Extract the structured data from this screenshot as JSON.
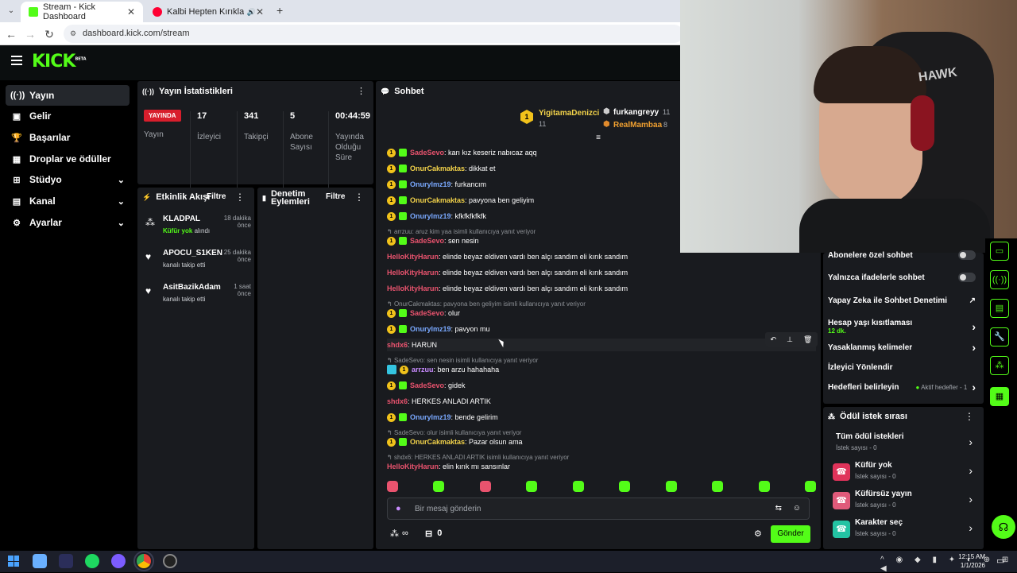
{
  "browser": {
    "tabs": [
      {
        "title": "Stream - Kick Dashboard",
        "favicon_color": "#53fc18"
      },
      {
        "title": "Kalbi Hepten Kırıklara (feat",
        "favicon_color": "#ff0033"
      }
    ],
    "new_tab": "+",
    "url": "dashboard.kick.com/stream"
  },
  "kick": {
    "logo": "KICK",
    "logo_badge": "BETA",
    "accent_color": "#53fc18"
  },
  "sidebar": {
    "items": [
      {
        "label": "Yayın",
        "icon": "broadcast-icon",
        "glyph": "((·))",
        "active": true
      },
      {
        "label": "Gelir",
        "icon": "revenue-icon",
        "glyph": "▣"
      },
      {
        "label": "Başarılar",
        "icon": "trophy-icon",
        "glyph": "🏆"
      },
      {
        "label": "Droplar ve ödüller",
        "icon": "gift-icon",
        "glyph": "▦"
      },
      {
        "label": "Stüdyo",
        "icon": "studio-icon",
        "glyph": "⊞",
        "expandable": true
      },
      {
        "label": "Kanal",
        "icon": "channel-icon",
        "glyph": "▤",
        "expandable": true
      },
      {
        "label": "Ayarlar",
        "icon": "settings-icon",
        "glyph": "⚙",
        "expandable": true
      }
    ]
  },
  "stats": {
    "title": "Yayın İstatistikleri",
    "live_badge": "YAYINDA",
    "live_label": "Yayın",
    "items": [
      {
        "value": "17",
        "label": "İzleyici"
      },
      {
        "value": "341",
        "label": "Takipçi"
      },
      {
        "value": "5",
        "label": "Abone Sayısı"
      },
      {
        "value": "00:44:59",
        "label": "Yayında Olduğu Süre"
      }
    ]
  },
  "activity": {
    "title": "Etkinlik Akışı",
    "filter": "Filtre",
    "events": [
      {
        "name": "KLADPAL",
        "time": "18 dakika önce",
        "highlight": "Küfür yok",
        "desc": " alındı",
        "icon": "reward-icon"
      },
      {
        "name": "APOCU_S1KEN",
        "time": "25 dakika önce",
        "highlight": "",
        "desc": "kanalı takip etti",
        "icon": "heart-icon"
      },
      {
        "name": "AsitBazikAdam",
        "time": "1 saat önce",
        "highlight": "",
        "desc": "kanalı takip etti",
        "icon": "heart-icon"
      }
    ]
  },
  "moderation": {
    "title": "Denetim Eylemleri",
    "filter": "Filtre"
  },
  "chat": {
    "title": "Sohbet",
    "leaderboard": [
      {
        "name": "YigitamaDenizci",
        "count": "11",
        "rank": "1"
      },
      {
        "name": "furkangreyy",
        "count": "11"
      },
      {
        "name": "RealMambaa",
        "count": "8"
      }
    ],
    "messages": [
      {
        "user": "SadeSevo",
        "color": "#e9536e",
        "badges": [
          "sub",
          "gift"
        ],
        "text": ": karı kız keseriz nabıcaz aqq"
      },
      {
        "user": "OnurCakmaktas",
        "color": "#f3d34a",
        "badges": [
          "sub",
          "gift"
        ],
        "text": ": dikkat et",
        "alt_user": "Onurylmz19",
        "alt_color": "#7aa9ff"
      },
      {
        "user": "Onurylmz19",
        "color": "#7aa9ff",
        "badges": [
          "sub",
          "gift"
        ],
        "text": ": furkancım"
      },
      {
        "user": "OnurCakmaktas",
        "color": "#f3d34a",
        "badges": [
          "sub",
          "gift"
        ],
        "text": ": pavyona ben geliyim"
      },
      {
        "user": "Onurylmz19",
        "color": "#7aa9ff",
        "badges": [
          "sub",
          "gift"
        ],
        "text": ": kfkfkfkfkfk"
      },
      {
        "reply": "arrzuu: aruz kim yaa isimli kullanıcıya yanıt veriyor"
      },
      {
        "user": "SadeSevo",
        "color": "#e9536e",
        "badges": [
          "sub",
          "gift"
        ],
        "text": ": sen nesin"
      },
      {
        "user": "HelloKityHarun",
        "color": "#e9536e",
        "badges": [],
        "text": ": elinde beyaz eldiven vardı ben alçı sandım eli kırık sandım"
      },
      {
        "user": "HelloKityHarun",
        "color": "#e9536e",
        "badges": [],
        "text": ": elinde beyaz eldiven vardı ben alçı sandım eli kırık sandım"
      },
      {
        "user": "HelloKityHarun",
        "color": "#e9536e",
        "badges": [],
        "text": ": elinde beyaz eldiven vardı ben alçı sandım eli kırık sandım"
      },
      {
        "reply": "OnurCakmaktas: pavyona ben geliyim isimli kullanıcıya yanıt veriyor"
      },
      {
        "user": "SadeSevo",
        "color": "#e9536e",
        "badges": [
          "sub",
          "gift"
        ],
        "text": ": olur"
      },
      {
        "user": "Onurylmz19",
        "color": "#7aa9ff",
        "badges": [
          "sub",
          "gift"
        ],
        "text": ": pavyon mu"
      },
      {
        "user": "shdx6",
        "color": "#e9536e",
        "badges": [],
        "text": ": HARUN",
        "hover": true
      },
      {
        "reply": "SadeSevo: sen nesin isimli kullanıcıya yanıt veriyor"
      },
      {
        "user": "arrzuu",
        "color": "#c98cff",
        "badges": [
          "verified",
          "sub"
        ],
        "text": ": ben arzu hahahaha"
      },
      {
        "user": "SadeSevo",
        "color": "#e9536e",
        "badges": [
          "sub",
          "gift"
        ],
        "text": ": gidek"
      },
      {
        "user": "shdx6",
        "color": "#e9536e",
        "badges": [],
        "text": ": HERKES ANLADI ARTIK"
      },
      {
        "user": "Onurylmz19",
        "color": "#7aa9ff",
        "badges": [
          "sub",
          "gift"
        ],
        "text": ": bende gelirim"
      },
      {
        "reply": "SadeSevo: olur isimli kullanıcıya yanıt veriyor"
      },
      {
        "user": "OnurCakmaktas",
        "color": "#f3d34a",
        "badges": [
          "sub",
          "gift"
        ],
        "text": ": Pazar olsun ama"
      },
      {
        "reply": "shdx6: HERKES ANLADI ARTIK isimli kullanıcıya yanıt veriyor"
      },
      {
        "user": "HelloKityHarun",
        "color": "#e9536e",
        "badges": [],
        "text": ": elin kırık mı sansınlar"
      }
    ],
    "badge_number": "1",
    "input_placeholder": "Bir mesaj gönderin",
    "points": "∞",
    "gifts": "0",
    "send": "Gönder"
  },
  "settings_panel": {
    "items": [
      {
        "label": "Abonelere özel sohbet",
        "type": "toggle"
      },
      {
        "label": "Yalnızca ifadelerle sohbet",
        "type": "toggle"
      },
      {
        "label": "Yapay Zeka ile Sohbet Denetimi",
        "type": "link"
      },
      {
        "label": "Hesap yaşı kısıtlaması",
        "sub": "12 dk.",
        "type": "chevron"
      },
      {
        "label": "Yasaklanmış kelimeler",
        "type": "chevron"
      },
      {
        "label": "İzleyici Yönlendir",
        "type": "none"
      },
      {
        "label": "Hedefleri belirleyin",
        "extra": "Aktif hedefler - 1",
        "type": "chevron"
      }
    ]
  },
  "rewards": {
    "title": "Ödül istek sırası",
    "items": [
      {
        "title": "Tüm ödül istekleri",
        "sub": "İstek sayısı - 0",
        "icon": "",
        "color": ""
      },
      {
        "title": "Küfür yok",
        "sub": "İstek sayısı - 0",
        "icon": "phone-icon",
        "color": "#e0335a"
      },
      {
        "title": "Küfürsüz yayın",
        "sub": "İstek sayısı - 0",
        "icon": "phone-icon",
        "color": "#e05a7a"
      },
      {
        "title": "Karakter seç",
        "sub": "İstek sayısı - 0",
        "icon": "phone-icon",
        "color": "#23c3a3"
      }
    ]
  },
  "taskbar": {
    "time": "12:15 AM",
    "date": "1/1/2026"
  }
}
